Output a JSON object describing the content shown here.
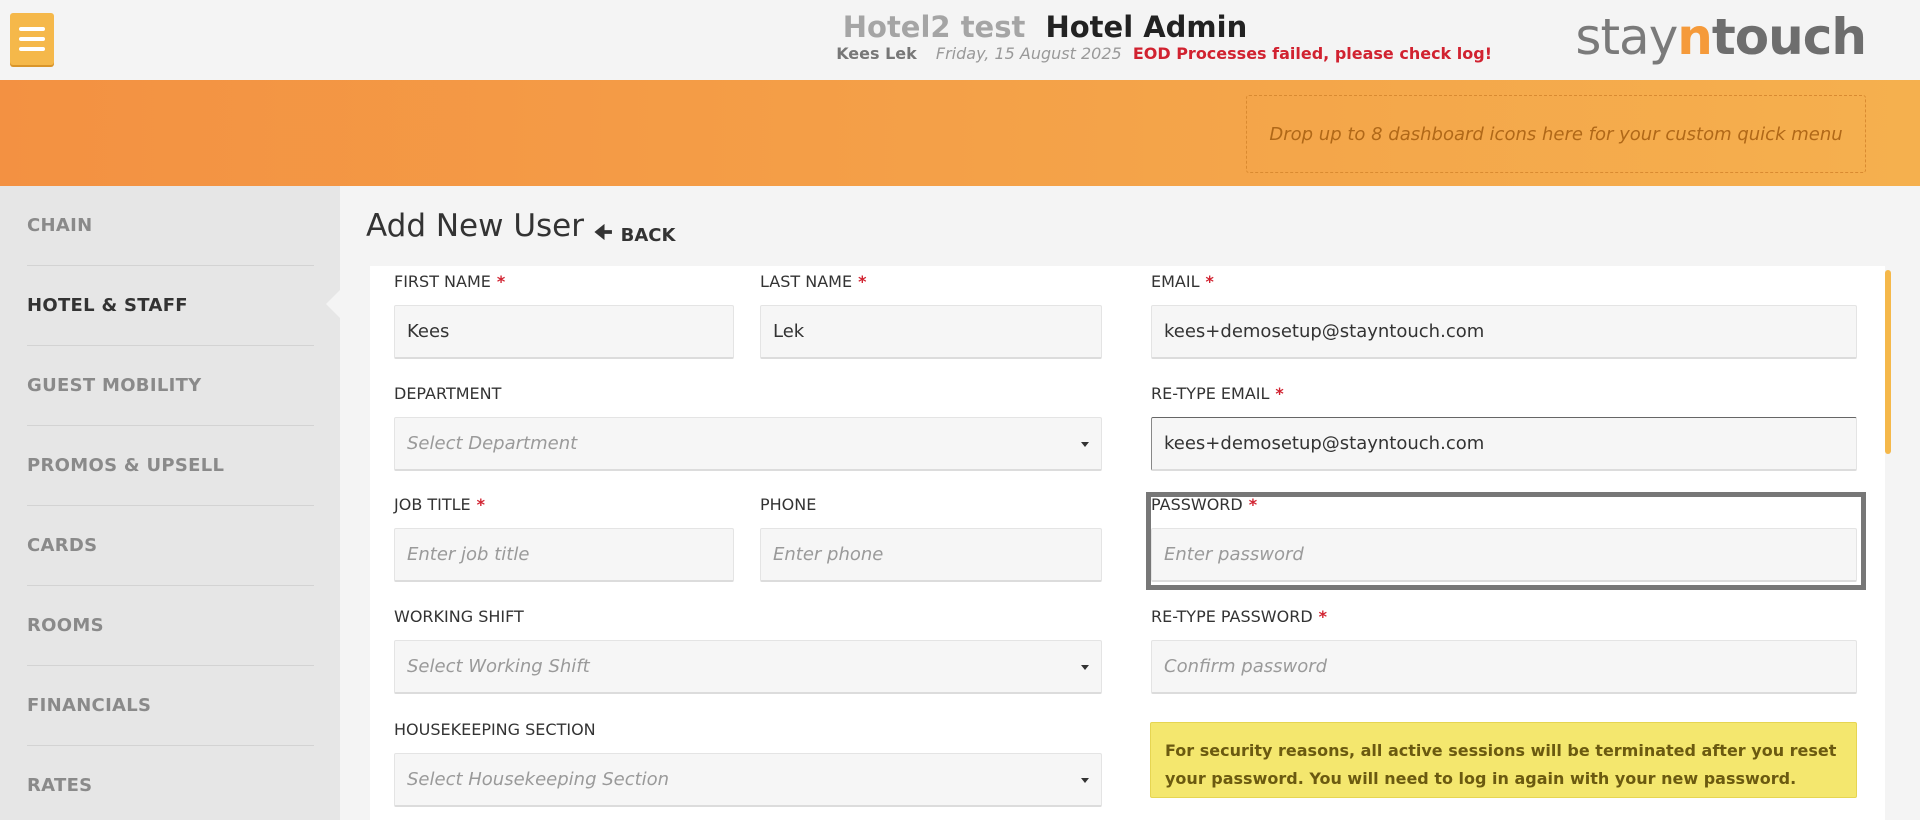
{
  "header": {
    "hotel_name": "Hotel2 test",
    "app_name": "Hotel Admin",
    "user_name": "Kees Lek",
    "date": "Friday, 15 August 2025",
    "eod_message": "EOD Processes failed, please check log!",
    "logo_prefix": "stay",
    "logo_n": "n",
    "logo_suffix": "touch"
  },
  "quick_menu": {
    "placeholder": "Drop up to 8 dashboard icons here for your custom quick menu"
  },
  "sidebar": {
    "items": [
      {
        "label": "CHAIN"
      },
      {
        "label": "HOTEL & STAFF"
      },
      {
        "label": "GUEST MOBILITY"
      },
      {
        "label": "PROMOS & UPSELL"
      },
      {
        "label": "CARDS"
      },
      {
        "label": "ROOMS"
      },
      {
        "label": "FINANCIALS"
      },
      {
        "label": "RATES"
      }
    ],
    "active": "HOTEL & STAFF"
  },
  "page": {
    "title": "Add New User",
    "back_label": "BACK"
  },
  "form": {
    "first_name": {
      "label": "FIRST NAME",
      "req": "*",
      "value": "Kees"
    },
    "last_name": {
      "label": "LAST NAME",
      "req": "*",
      "value": "Lek"
    },
    "email": {
      "label": "EMAIL",
      "req": "*",
      "value": "kees+demosetup@stayntouch.com"
    },
    "department": {
      "label": "DEPARTMENT",
      "placeholder": "Select Department"
    },
    "retype_email": {
      "label": "RE-TYPE EMAIL",
      "req": "*",
      "value": "kees+demosetup@stayntouch.com"
    },
    "job_title": {
      "label": "JOB TITLE",
      "req": "*",
      "placeholder": "Enter job title"
    },
    "phone": {
      "label": "PHONE",
      "placeholder": "Enter phone"
    },
    "password": {
      "label": "PASSWORD",
      "req": "*",
      "placeholder": "Enter password"
    },
    "working_shift": {
      "label": "WORKING SHIFT",
      "placeholder": "Select Working Shift"
    },
    "retype_password": {
      "label": "RE-TYPE PASSWORD",
      "req": "*",
      "placeholder": "Confirm password"
    },
    "housekeeping_section": {
      "label": "HOUSEKEEPING SECTION",
      "placeholder": "Select Housekeeping Section"
    },
    "notice": "For security reasons, all active sessions will be terminated after you reset your password. You will need to log in again with your new password."
  }
}
